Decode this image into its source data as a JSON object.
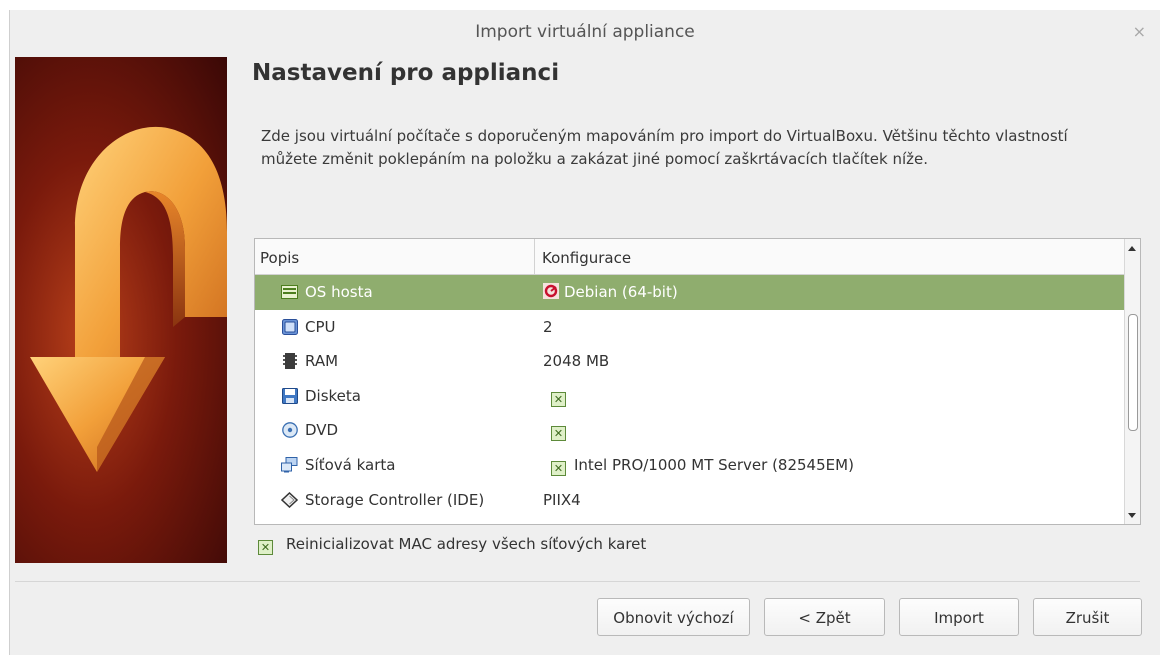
{
  "window": {
    "title": "Import virtuální appliance",
    "close_glyph": "×"
  },
  "page": {
    "heading": "Nastavení pro applianci",
    "description": "Zde jsou virtuální počítače s doporučeným mapováním pro import do VirtualBoxu. Většinu těchto vlastností můžete změnit poklepáním na položku a zakázat jiné pomocí zaškrtávacích tlačítek níže."
  },
  "table": {
    "headers": [
      "Popis",
      "Konfigurace"
    ],
    "rows": [
      {
        "label": "OS hosta",
        "value": "Debian (64-bit)",
        "icon": "os-icon",
        "value_icon": "debian-icon",
        "selected": true
      },
      {
        "label": "CPU",
        "value": "2",
        "icon": "cpu-icon"
      },
      {
        "label": "RAM",
        "value": "2048 MB",
        "icon": "ram-icon"
      },
      {
        "label": "Disketa",
        "value": "",
        "icon": "floppy-icon",
        "checkbox": true
      },
      {
        "label": "DVD",
        "value": "",
        "icon": "dvd-icon",
        "checkbox": true
      },
      {
        "label": "Síťová karta",
        "value": "Intel PRO/1000 MT Server (82545EM)",
        "icon": "network-icon",
        "checkbox": true
      },
      {
        "label": "Storage Controller (IDE)",
        "value": "PIIX4",
        "icon": "storage-icon"
      }
    ]
  },
  "options": {
    "reinit_mac_label": "Reinicializovat MAC adresy všech síťových karet",
    "reinit_mac_checked": true,
    "check_glyph": "✕"
  },
  "buttons": {
    "restore_defaults": "Obnovit výchozí",
    "back": "< Zpět",
    "import": "Import",
    "cancel": "Zrušit"
  },
  "colors": {
    "selection": "#8fad6e",
    "checkbox_border": "#5d8a3a",
    "banner_arrow": "#f2a03a"
  }
}
